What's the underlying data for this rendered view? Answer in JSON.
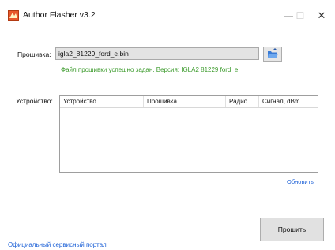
{
  "window": {
    "title": "Author Flasher v3.2",
    "min_icon": "minimize-icon",
    "max_icon": "maximize-icon",
    "close_icon": "close-icon"
  },
  "firmware": {
    "label": "Прошивка:",
    "value": "igla2_81229_ford_e.bin",
    "browse_icon": "open-folder-icon",
    "status": "Файл прошивки успешно задан. Версия: IGLA2 81229 ford_e",
    "status_color": "#3a9a2a"
  },
  "device": {
    "label": "Устройство:",
    "columns": [
      "Устройство",
      "Прошивка",
      "Радио",
      "Сигнал, dBm"
    ],
    "rows": []
  },
  "refresh_link": "Обновить",
  "flash_button": "Прошить",
  "portal_link": "Официальный сервисный портал",
  "colors": {
    "link": "#1a5fd6",
    "app_icon": "#e8572a"
  }
}
